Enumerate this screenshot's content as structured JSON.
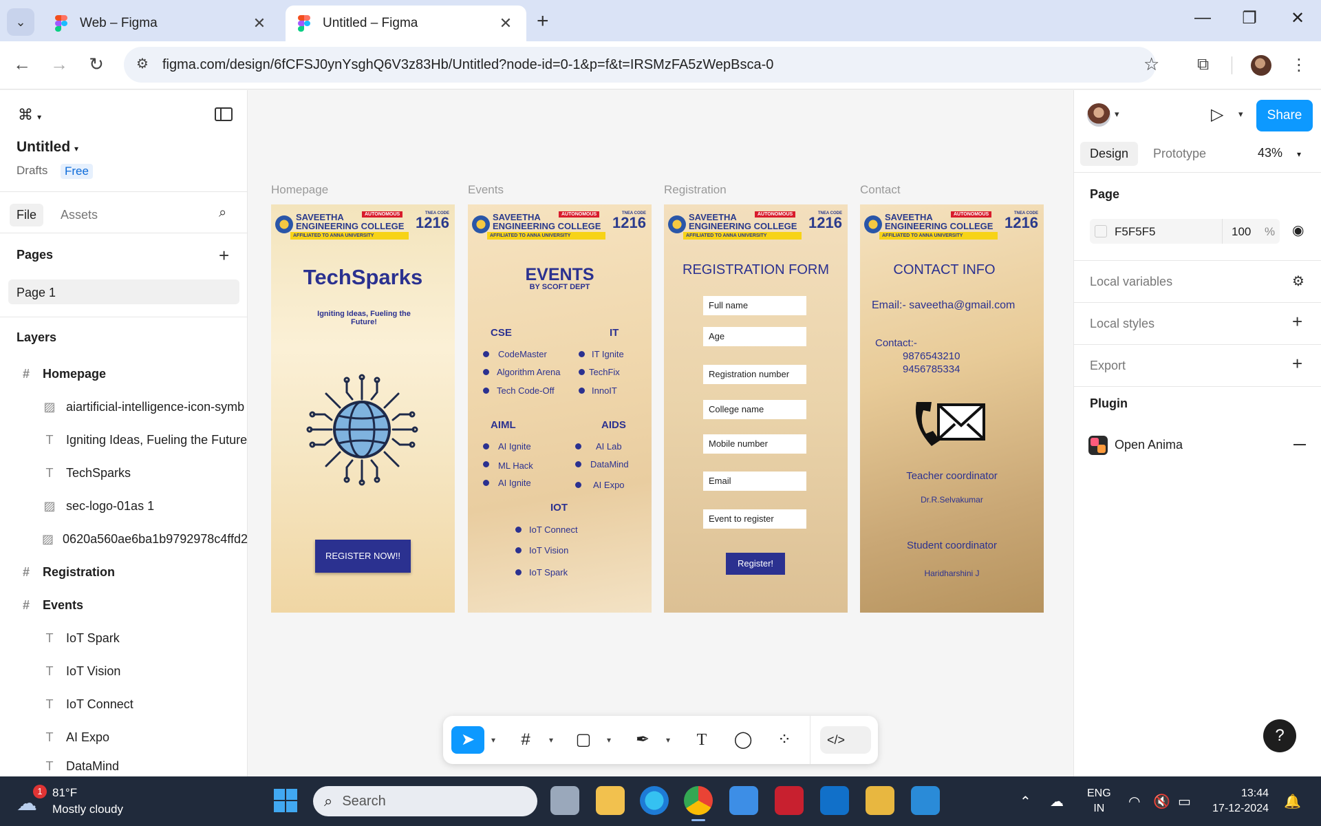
{
  "browser": {
    "tabs": [
      {
        "title": "Web – Figma",
        "active": false
      },
      {
        "title": "Untitled – Figma",
        "active": true
      }
    ],
    "url": "figma.com/design/6fCFSJ0ynYsghQ6V3z83Hb/Untitled?node-id=0-1&p=f&t=IRSMzFA5zWepBsca-0"
  },
  "file": {
    "name": "Untitled",
    "location": "Drafts",
    "plan": "Free"
  },
  "left_panel": {
    "tabs": [
      "File",
      "Assets"
    ],
    "pages_title": "Pages",
    "pages": [
      "Page 1"
    ],
    "layers_title": "Layers",
    "layers": [
      {
        "name": "Homepage",
        "type": "frame"
      },
      {
        "name": "aiartificial-intelligence-icon-symb",
        "type": "image"
      },
      {
        "name": "Igniting Ideas, Fueling the Future",
        "type": "text"
      },
      {
        "name": "TechSparks",
        "type": "text"
      },
      {
        "name": "sec-logo-01as 1",
        "type": "image"
      },
      {
        "name": "0620a560ae6ba1b9792978c4ffd2",
        "type": "image"
      },
      {
        "name": "Registration",
        "type": "frame"
      },
      {
        "name": "Events",
        "type": "frame"
      },
      {
        "name": "IoT Spark",
        "type": "text"
      },
      {
        "name": "IoT Vision",
        "type": "text"
      },
      {
        "name": "IoT Connect",
        "type": "text"
      },
      {
        "name": "AI Expo",
        "type": "text"
      },
      {
        "name": "DataMind",
        "type": "text"
      }
    ]
  },
  "canvas": {
    "frame_labels": [
      "Homepage",
      "Events",
      "Registration",
      "Contact"
    ],
    "header": {
      "college_line1": "SAVEETHA",
      "college_line2": "ENGINEERING COLLEGE",
      "autonomous": "AUTONOMOUS",
      "affiliated": "AFFILIATED TO ANNA UNIVERSITY",
      "tnea_label": "TNEA CODE",
      "tnea_code": "1216"
    },
    "homepage": {
      "title": "TechSparks",
      "tagline": "Igniting Ideas, Fueling the Future!",
      "button": "REGISTER NOW!!"
    },
    "events": {
      "title": "EVENTS",
      "subtitle": "BY SCOFT DEPT",
      "groups": [
        {
          "name": "CSE",
          "items": [
            "CodeMaster",
            "Algorithm Arena",
            "Tech Code-Off"
          ]
        },
        {
          "name": "IT",
          "items": [
            "IT Ignite",
            "TechFix",
            "InnoIT"
          ]
        },
        {
          "name": "AIML",
          "items": [
            "AI Ignite",
            "ML Hack",
            "AI Ignite"
          ]
        },
        {
          "name": "AIDS",
          "items": [
            "AI Lab",
            "DataMind",
            "AI Expo"
          ]
        },
        {
          "name": "IOT",
          "items": [
            "IoT Connect",
            "IoT Vision",
            "IoT Spark"
          ]
        }
      ]
    },
    "registration": {
      "title": "REGISTRATION FORM",
      "fields": [
        "Full name",
        "Age",
        "Registration number",
        "College name",
        "Mobile number",
        "Email",
        "Event to register"
      ],
      "button": "Register!"
    },
    "contact": {
      "title": "CONTACT INFO",
      "email": "Email:- saveetha@gmail.com",
      "contact_label": "Contact:-",
      "phones": [
        "9876543210",
        "9456785334"
      ],
      "teacher_title": "Teacher coordinator",
      "teacher_name": "Dr.R.Selvakumar",
      "student_title": "Student coordinator",
      "student_name": "Haridharshini J"
    }
  },
  "right_panel": {
    "share": "Share",
    "tabs": [
      "Design",
      "Prototype"
    ],
    "zoom": "43%",
    "page_section": "Page",
    "page_color": "F5F5F5",
    "page_opacity": "100",
    "percent": "%",
    "local_variables": "Local variables",
    "local_styles": "Local styles",
    "export": "Export",
    "plugin_section": "Plugin",
    "plugin_name": "Open Anima"
  },
  "taskbar": {
    "weather_badge": "1",
    "temperature": "81°F",
    "weather": "Mostly cloudy",
    "search": "Search",
    "lang1": "ENG",
    "lang2": "IN",
    "time": "13:44",
    "date": "17-12-2024"
  }
}
